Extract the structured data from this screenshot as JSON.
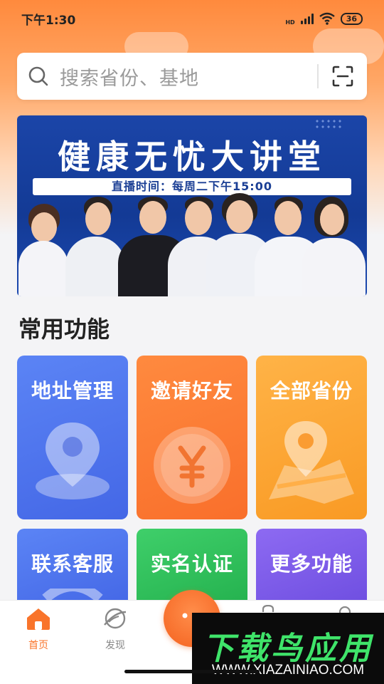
{
  "status_bar": {
    "time": "下午1:30",
    "network": "HD",
    "battery": "36"
  },
  "search": {
    "placeholder": "搜索省份、基地"
  },
  "banner": {
    "title": "健康无忧大讲堂",
    "subtitle": "直播时间：每周二下午15:00"
  },
  "section": {
    "title": "常用功能"
  },
  "functions": [
    {
      "label": "地址管理",
      "icon": "location-pin-icon",
      "color": "#4f74ee"
    },
    {
      "label": "邀请好友",
      "icon": "yen-coin-icon",
      "color": "#fb7b35"
    },
    {
      "label": "全部省份",
      "icon": "map-pin-icon",
      "color": "#fca533"
    },
    {
      "label": "联系客服",
      "icon": "headset-icon",
      "color": "#4f74ee"
    },
    {
      "label": "实名认证",
      "icon": "id-card-icon",
      "color": "#2fc05a"
    },
    {
      "label": "更多功能",
      "icon": "more-icon",
      "color": "#7d5ce9"
    }
  ],
  "tabbar": {
    "items": [
      {
        "label": "首页",
        "icon": "home-icon",
        "active": true
      },
      {
        "label": "发现",
        "icon": "planet-icon",
        "active": false
      }
    ],
    "accent": "#f9742b"
  },
  "watermark": {
    "title": "下载鸟应用",
    "url": "WWW.XIAZAINIAO.COM"
  }
}
